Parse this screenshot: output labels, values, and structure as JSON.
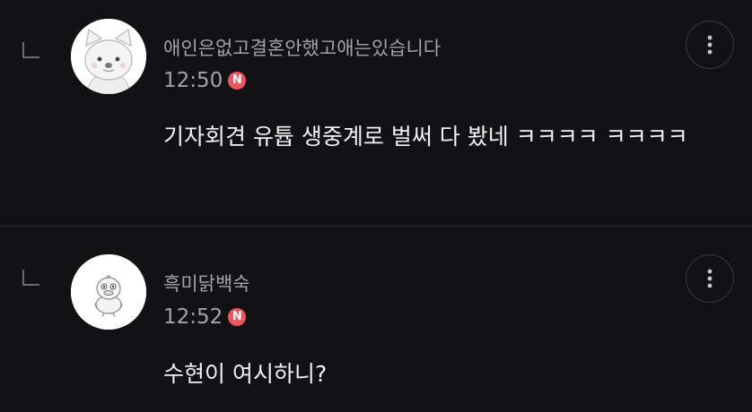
{
  "comments": [
    {
      "nickname": "애인은없고결혼안했고애는있습니다",
      "time": "12:50",
      "badge": "N",
      "text": "기자회견 유튭 생중계로 벌써 다 봤네 ㅋㅋㅋㅋ ㅋㅋㅋㅋ",
      "avatar_icon": "white-cat-character-avatar",
      "menu_icon": "more-vertical-icon"
    },
    {
      "nickname": "흑미닭백숙",
      "time": "12:52",
      "badge": "N",
      "text": "수현이 여시하니?",
      "avatar_icon": "duck-character-avatar",
      "menu_icon": "more-vertical-icon"
    }
  ],
  "colors": {
    "background": "#121214",
    "nickname": "#a3a3a8",
    "body_text": "#f1f1f3",
    "new_badge": "#f0555f",
    "divider": "#2a2a2e"
  }
}
